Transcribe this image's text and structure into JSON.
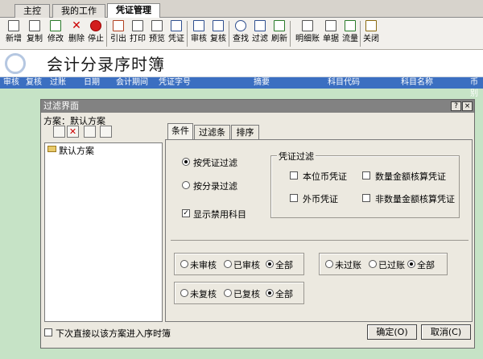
{
  "tabs": [
    {
      "label": "主控台"
    },
    {
      "label": "我的工作台"
    },
    {
      "label": "凭证管理",
      "close": "×"
    }
  ],
  "toolbar": [
    {
      "label": "新增",
      "icon": "new-doc-icon"
    },
    {
      "label": "复制",
      "icon": "copy-icon"
    },
    {
      "label": "修改",
      "icon": "edit-icon"
    },
    {
      "label": "删除",
      "icon": "delete-icon"
    },
    {
      "label": "停止",
      "icon": "stop-icon"
    },
    {
      "label": "引出",
      "icon": "export-icon"
    },
    {
      "label": "打印",
      "icon": "print-icon"
    },
    {
      "label": "预览",
      "icon": "preview-icon"
    },
    {
      "label": "凭证",
      "icon": "voucher-icon"
    },
    {
      "label": "审核",
      "icon": "audit-icon"
    },
    {
      "label": "复核",
      "icon": "recheck-icon"
    },
    {
      "label": "查找",
      "icon": "find-icon"
    },
    {
      "label": "过滤",
      "icon": "filter-icon"
    },
    {
      "label": "刷新",
      "icon": "refresh-icon"
    },
    {
      "label": "明细账",
      "icon": "ledger-icon"
    },
    {
      "label": "单据",
      "icon": "document-icon"
    },
    {
      "label": "流量",
      "icon": "flow-icon"
    },
    {
      "label": "关闭",
      "icon": "exit-icon"
    }
  ],
  "page_title": "会计分录序时簿",
  "columns": [
    "审核",
    "复核",
    "过账",
    "日期",
    "会计期间",
    "凭证字号",
    "摘要",
    "科目代码",
    "科目名称",
    "币别"
  ],
  "dialog": {
    "title": "过滤界面",
    "help_btn": "?",
    "close_btn": "×",
    "plan_label": "方案：默认方案",
    "tree_item": "默认方案",
    "tabs": [
      "条件",
      "过滤条件",
      "排序"
    ],
    "filter_mode": {
      "by_voucher": "按凭证过滤",
      "by_entry": "按分录过滤",
      "show_disabled": "显示禁用科目"
    },
    "voucher_filter": {
      "title": "凭证过滤",
      "base_currency": "本位币凭证",
      "foreign_currency": "外币凭证",
      "qty_amount": "数量金额核算凭证",
      "non_qty_amount": "非数量金额核算凭证"
    },
    "audit_status": {
      "options": [
        "未审核",
        "已审核",
        "全部"
      ],
      "selected": "全部"
    },
    "post_status": {
      "options": [
        "未过账",
        "已过账",
        "全部"
      ],
      "selected": "全部"
    },
    "recheck_status": {
      "options": [
        "未复核",
        "已复核",
        "全部"
      ],
      "selected": "全部"
    },
    "next_time": "下次直接以该方案进入序时簿",
    "ok": "确定(O)",
    "cancel": "取消(C)"
  }
}
